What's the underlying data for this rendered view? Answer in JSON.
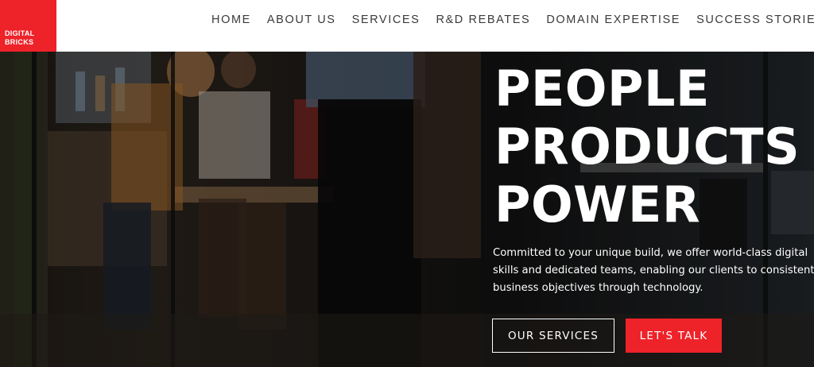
{
  "brand": {
    "line1": "DIGITAL",
    "line2": "BRICKS",
    "color": "#ee2229"
  },
  "nav": {
    "items": [
      "HOME",
      "ABOUT US",
      "SERVICES",
      "R&D REBATES",
      "DOMAIN EXPERTISE",
      "SUCCESS STORIES"
    ]
  },
  "hero": {
    "title_lines": [
      "PEOPLE",
      "PRODUCTS",
      "POWER"
    ],
    "description_lines": [
      "Committed to your unique build, we offer world-class digital",
      "skills and dedicated teams, enabling our clients to consistent",
      "business objectives through technology."
    ],
    "primary_button": "OUR SERVICES",
    "secondary_button": "LET'S TALK"
  }
}
